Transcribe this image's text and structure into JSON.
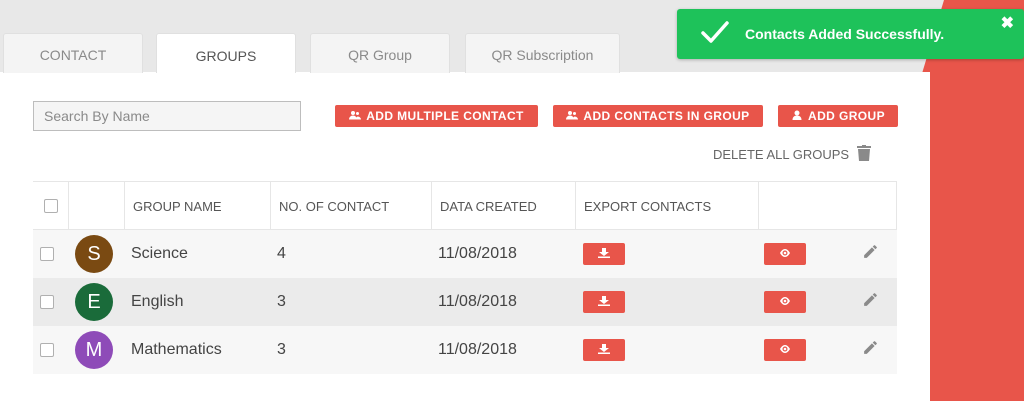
{
  "tabs": [
    {
      "label": "CONTACT",
      "active": false
    },
    {
      "label": "GROUPS",
      "active": true
    },
    {
      "label": "QR Group",
      "active": false
    },
    {
      "label": "QR Subscription",
      "active": false
    }
  ],
  "search": {
    "placeholder": "Search By Name"
  },
  "buttons": {
    "add_multiple_contact": "ADD MULTIPLE CONTACT",
    "add_contacts_in_group": "ADD CONTACTS IN GROUP",
    "add_group": "ADD GROUP"
  },
  "delete_all_groups": "DELETE ALL GROUPS",
  "table": {
    "headers": {
      "group_name": "GROUP NAME",
      "no_of_contact": "NO. OF CONTACT",
      "data_created": "DATA CREATED",
      "export_contacts": "EXPORT CONTACTS"
    },
    "rows": [
      {
        "initial": "S",
        "name": "Science",
        "count": "4",
        "date": "11/08/2018",
        "avatar_color": "#7a4a12"
      },
      {
        "initial": "E",
        "name": "English",
        "count": "3",
        "date": "11/08/2018",
        "avatar_color": "#1a6b3a"
      },
      {
        "initial": "M",
        "name": "Mathematics",
        "count": "3",
        "date": "11/08/2018",
        "avatar_color": "#8e4bb8"
      }
    ]
  },
  "toast": {
    "message": "Contacts Added Successfully.",
    "close_symbol": "✖"
  },
  "colors": {
    "accent": "#e8554a",
    "success": "#1ec25a"
  }
}
